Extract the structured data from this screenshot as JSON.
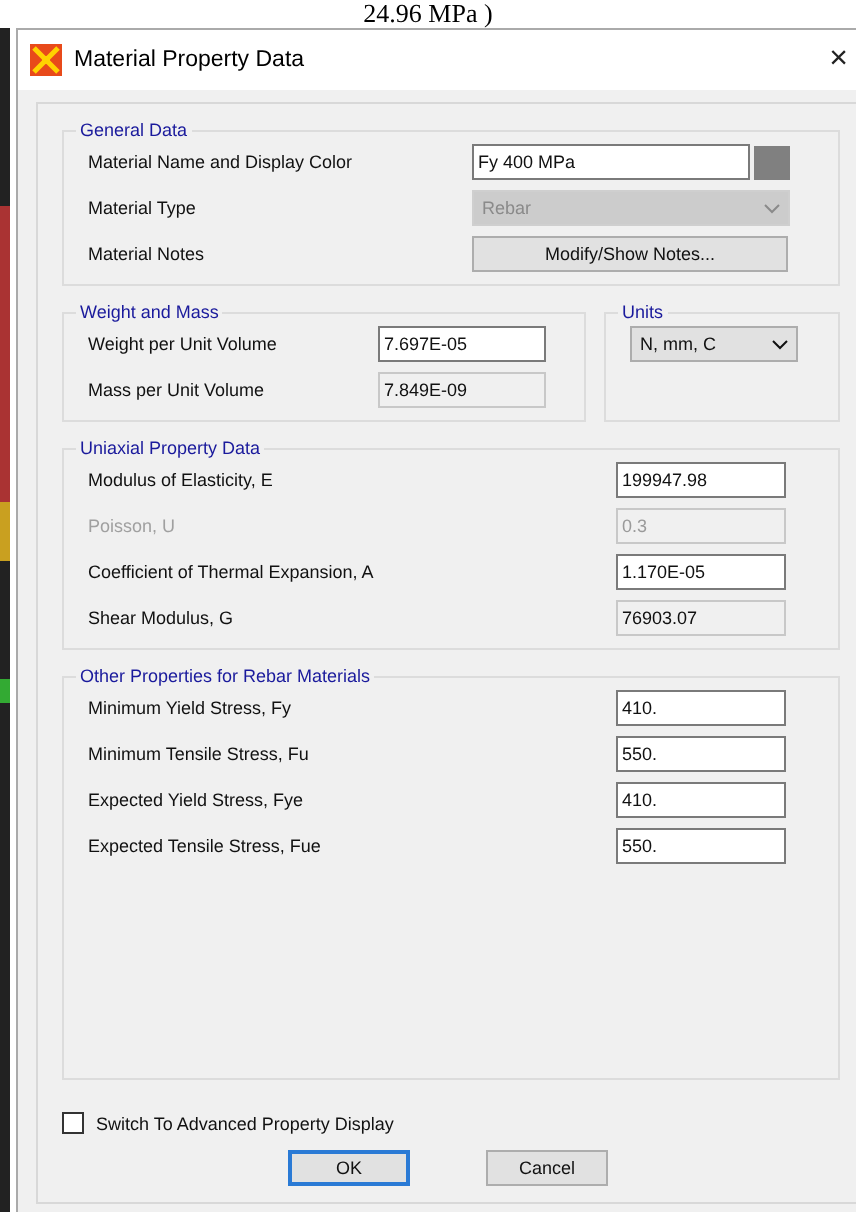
{
  "background_text": "24.96 MPa )",
  "window": {
    "title": "Material Property Data",
    "close": "×"
  },
  "general_data": {
    "title": "General Data",
    "rows": [
      {
        "kind": "color_text",
        "label": "Material Name and Display Color",
        "value": "Fy 400 MPa"
      },
      {
        "kind": "dropdown",
        "label": "Material Type",
        "value": "Rebar",
        "disabled": true
      },
      {
        "kind": "button",
        "label": "Material Notes",
        "value": "Modify/Show Notes..."
      }
    ]
  },
  "weight_and_mass": {
    "title": "Weight and Mass",
    "rows": [
      {
        "label": "Weight per Unit Volume",
        "value": "7.697E-05",
        "disabled": false,
        "editable": true
      },
      {
        "label": "Mass per Unit Volume",
        "value": "7.849E-09",
        "disabled": false,
        "editable": false
      }
    ]
  },
  "units": {
    "title": "Units",
    "value": "N, mm, C"
  },
  "uniaxial": {
    "title": "Uniaxial Property Data",
    "rows": [
      {
        "label": "Modulus of Elasticity,  E",
        "value": "199947.98",
        "disabled": false,
        "editable": true
      },
      {
        "label": "Poisson,  U",
        "value": "0.3",
        "disabled": true,
        "editable": false
      },
      {
        "label": "Coefficient of Thermal Expansion,  A",
        "value": "1.170E-05",
        "disabled": false,
        "editable": true
      },
      {
        "label": "Shear Modulus,  G",
        "value": "76903.07",
        "disabled": false,
        "editable": false
      }
    ]
  },
  "rebar": {
    "title": "Other Properties for Rebar Materials",
    "rows": [
      {
        "label": "Minimum Yield Stress, Fy",
        "value": "410.",
        "disabled": false,
        "editable": true
      },
      {
        "label": "Minimum Tensile Stress, Fu",
        "value": "550.",
        "disabled": false,
        "editable": true
      },
      {
        "label": "Expected Yield Stress, Fye",
        "value": "410.",
        "disabled": false,
        "editable": true
      },
      {
        "label": "Expected Tensile Stress, Fue",
        "value": "550.",
        "disabled": false,
        "editable": true
      }
    ]
  },
  "advanced_checkbox": {
    "label": "Switch To Advanced Property Display",
    "checked": false
  },
  "buttons": [
    {
      "label": "OK",
      "default": true
    },
    {
      "label": "Cancel",
      "default": false
    }
  ]
}
